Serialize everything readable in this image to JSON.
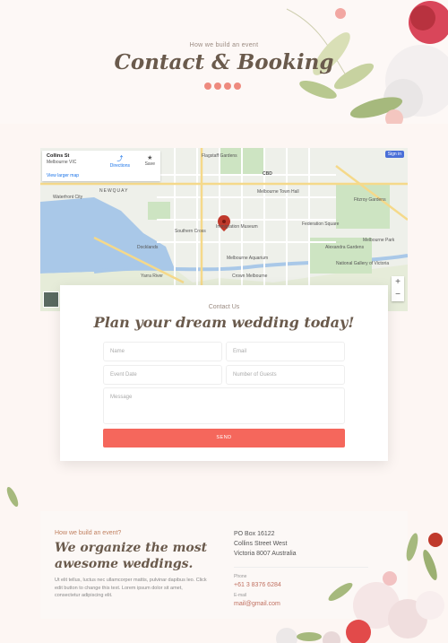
{
  "hero": {
    "eyebrow": "How we build an event",
    "title": "Contact & Booking",
    "social_icons": [
      "facebook-icon",
      "twitter-icon",
      "linkedin-icon",
      "instagram-icon"
    ],
    "accent": "#ee8a7e"
  },
  "map": {
    "place_name": "Collins St",
    "place_address": "Melbourne VIC",
    "larger_map_link": "View larger map",
    "directions_label": "Directions",
    "save_label": "Save",
    "sign_in_label": "Sign in",
    "zoom_in": "+",
    "zoom_out": "−",
    "labels": [
      "NEWQUAY",
      "CBD",
      "Melbourne Town Hall",
      "Immigration Museum",
      "Melbourne Aquarium",
      "Southern Cross",
      "Flagstaff Gardens",
      "Fitzroy Gardens",
      "Waterfront City",
      "Melbourne Park",
      "Yarra River",
      "Crown Melbourne",
      "Federation Square",
      "Alexandra Gardens",
      "National Gallery of Victoria",
      "Docklands"
    ]
  },
  "form": {
    "eyebrow": "Contact Us",
    "title": "Plan your dream wedding today!",
    "name_placeholder": "Name",
    "email_placeholder": "Email",
    "date_placeholder": "Event Date",
    "guests_placeholder": "Number of Guests",
    "message_placeholder": "Message",
    "send_label": "SEND",
    "button_color": "#f5675c"
  },
  "footer": {
    "eyebrow": "How we build an event?",
    "title": "We organize the most awesome weddings.",
    "body": "Ut elit tellus, luctus nec ullamcorper mattis, pulvinar dapibus leo. Click edit button to change this text. Lorem ipsum dolor sit amet, consectetur adipiscing elit.",
    "address_lines": [
      "PO Box 16122",
      "Collins Street West",
      "Victoria 8007 Australia"
    ],
    "phone_label": "Phone",
    "phone": "+61 3 8376 6284",
    "email_label": "E-mail",
    "email": "mail@gmail.com"
  }
}
